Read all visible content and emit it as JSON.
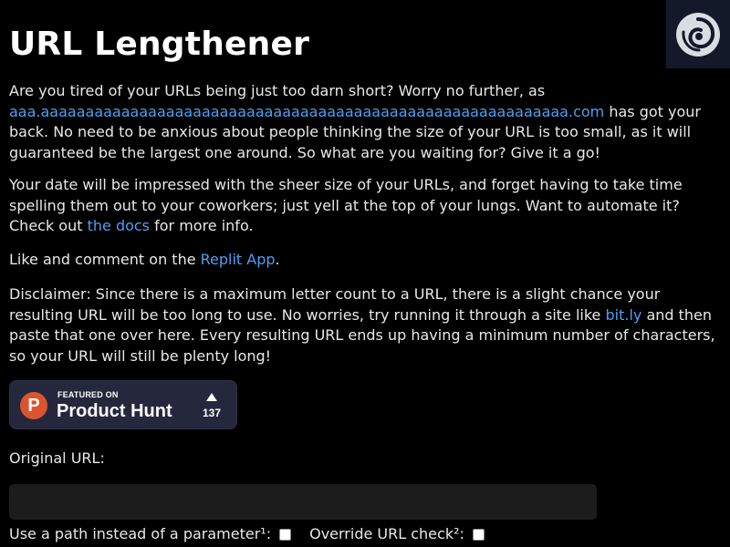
{
  "header": {
    "title": "URL Lengthener",
    "corner_icon": "spiral-logo-icon",
    "corner_bg": "#14192a"
  },
  "intro": {
    "p1_before": "Are you tired of your URLs being just too darn short? Worry no further, as ",
    "p1_link": "aaa.aaaaaaaaaaaaaaaaaaaaaaaaaaaaaaaaaaaaaaaaaaaaaaaaaaaaaaaaaaa.com",
    "p1_after": " has got your back. No need to be anxious about people thinking the size of your URL is too small, as it will guaranteed be the largest one around. So what are you waiting for? Give it a go!",
    "p2_before": "Your date will be impressed with the sheer size of your URLs, and forget having to take time spelling them out to your coworkers; just yell at the top of your lungs. Want to automate it? Check out ",
    "p2_link": "the docs",
    "p2_after": " for more info.",
    "p3_before": "Like and comment on the ",
    "p3_link": "Replit App",
    "p3_after": ".",
    "p4_before": "Disclaimer: Since there is a maximum letter count to a URL, there is a slight chance your resulting URL will be too long to use. No worries, try running it through a site like ",
    "p4_link": "bit.ly",
    "p4_after": " and then paste that one over here. Every resulting URL ends up having a minimum number of characters, so your URL will still be plenty long!"
  },
  "product_hunt": {
    "logo_letter": "P",
    "featured_label": "FEATURED ON",
    "name": "Product Hunt",
    "upvote_icon": "upvote-triangle-icon",
    "count": "137",
    "accent": "#da552f",
    "badge_bg": "#25273c"
  },
  "form": {
    "original_url_label": "Original URL:",
    "original_url_value": "",
    "original_url_placeholder": "",
    "path_option_label": "Use a path instead of a parameter¹:",
    "path_option_checked": false,
    "override_option_label": "Override URL check²:",
    "override_option_checked": false
  },
  "colors": {
    "background": "#000000",
    "text": "#e8e8e8",
    "link": "#4d9ff0",
    "input_bg": "#1c1c1c"
  }
}
